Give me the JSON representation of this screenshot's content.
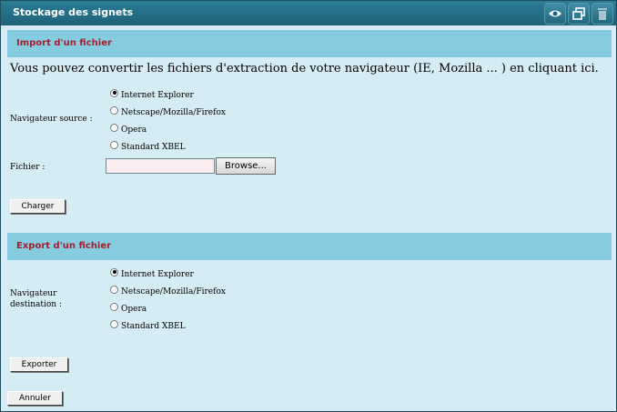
{
  "window": {
    "title": "Stockage des signets",
    "icons": [
      "eye-icon",
      "restore-window-icon",
      "trash-icon"
    ]
  },
  "import": {
    "header": "Import d'un fichier",
    "intro": "Vous pouvez convertir les fichiers d'extraction de votre navigateur (IE, Mozilla ... ) en cliquant ici.",
    "source_label": "Navigateur source :",
    "options": [
      "Internet Explorer",
      "Netscape/Mozilla/Firefox",
      "Opera",
      "Standard XBEL"
    ],
    "selected": "Internet Explorer",
    "file_label": "Fichier :",
    "file_value": "",
    "browse_label": "Browse...",
    "load_button": "Charger"
  },
  "export": {
    "header": "Export d'un fichier",
    "dest_label_line1": "Navigateur",
    "dest_label_line2": "destination :",
    "options": [
      "Internet Explorer",
      "Netscape/Mozilla/Firefox",
      "Opera",
      "Standard XBEL"
    ],
    "selected": "Internet Explorer",
    "export_button": "Exporter"
  },
  "cancel_button": "Annuler",
  "colors": {
    "titlebar": "#1d6278",
    "panel_bg": "#d6ecf4",
    "section_header_bg": "#86cce0",
    "section_header_text": "#a3202b"
  }
}
